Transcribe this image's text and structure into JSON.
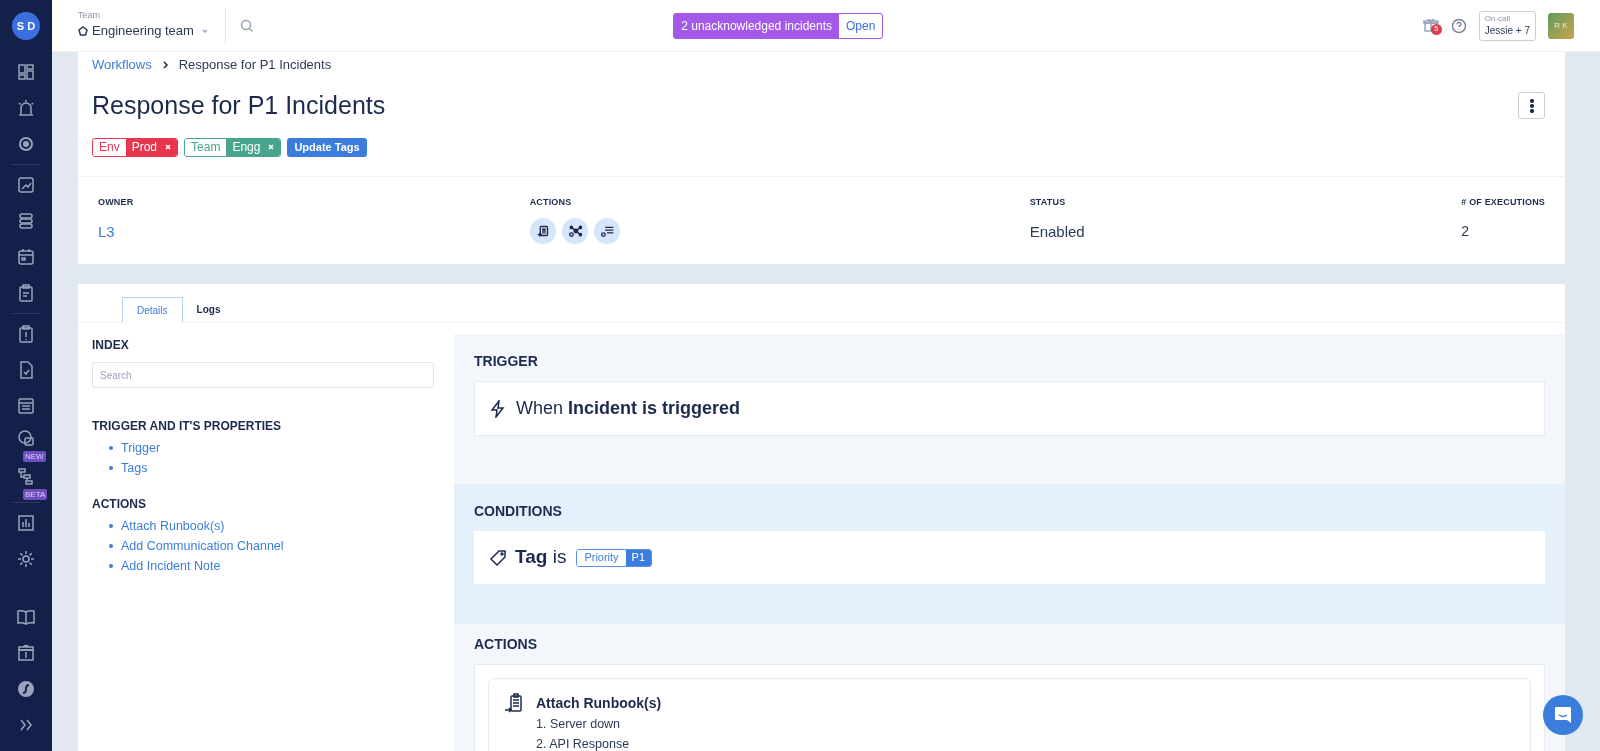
{
  "sidebar": {
    "avatar": "S D",
    "badges": [
      {
        "text": "NEW"
      },
      {
        "text": "BETA"
      }
    ]
  },
  "topbar": {
    "team_label": "Team",
    "team": "Engineering team",
    "incidents": "2 unacknowledged incidents",
    "incidents_action": "Open",
    "gift_count": "5",
    "oncall_label": "On-call",
    "oncall": "Jessie + 7",
    "user": "R K"
  },
  "breadcrumb": [
    "Workflows",
    "Response for P1 Incidents"
  ],
  "title": "Response for P1 Incidents",
  "tags": [
    {
      "key": "Env",
      "value": "Prod",
      "color": "#e8364f"
    },
    {
      "key": "Team",
      "value": "Engg",
      "color": "#4aa58f"
    }
  ],
  "update_tags": "Update Tags",
  "meta": {
    "owner_label": "OWNER",
    "owner": "L3",
    "actions_label": "ACTIONS",
    "status_label": "STATUS",
    "status": "Enabled",
    "executions_label": "# OF EXECUTIONS",
    "executions": "2"
  },
  "tabs": [
    {
      "label": "Details",
      "selected": true
    },
    {
      "label": "Logs",
      "selected": false
    }
  ],
  "index": {
    "heading": "INDEX",
    "search": {
      "placeholder": "Search"
    },
    "groups": [
      {
        "title": "TRIGGER AND IT'S PROPERTIES",
        "links": [
          "Trigger",
          "Tags"
        ]
      },
      {
        "title": "ACTIONS",
        "links": [
          "Attach Runbook(s)",
          "Add Communication Channel",
          "Add Incident Note"
        ]
      }
    ]
  },
  "trigger": {
    "heading": "TRIGGER",
    "text": "When **Incident is triggered**"
  },
  "conditions": {
    "heading": "CONDITIONS",
    "text": "**Tag** is",
    "tag_key": "Priority",
    "tag_value": "P1"
  },
  "actions": {
    "heading": "ACTIONS",
    "items": [
      {
        "title": "Attach Runbook(s)",
        "steps": [
          "1. Server down",
          "2. API Response"
        ]
      }
    ]
  }
}
